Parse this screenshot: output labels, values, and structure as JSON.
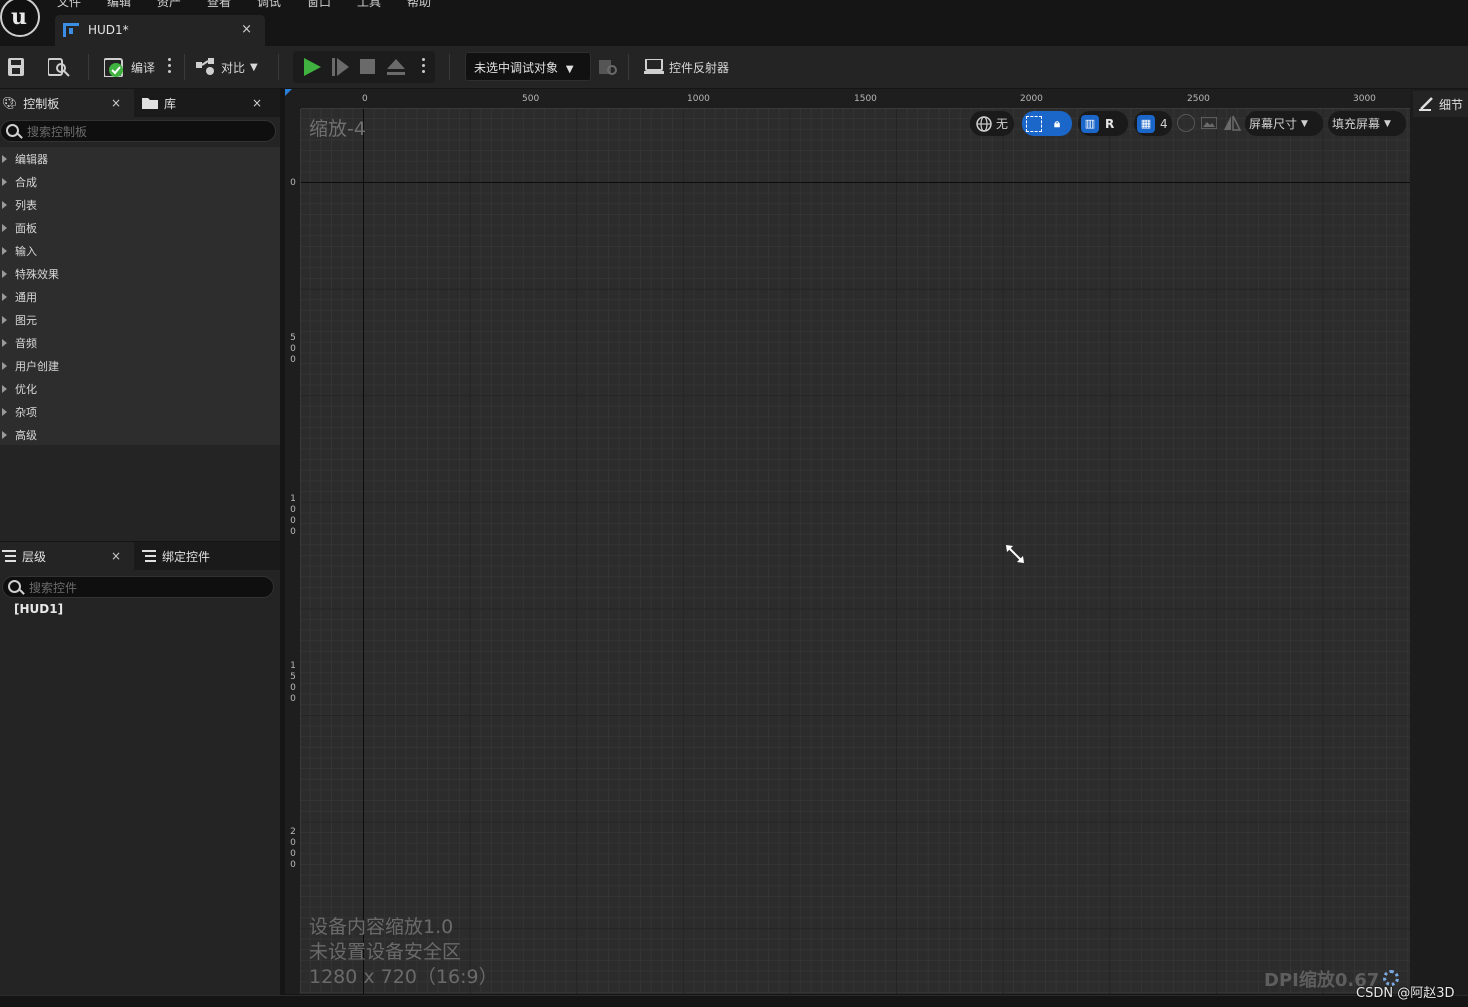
{
  "menu": {
    "items": [
      "文件",
      "编辑",
      "资产",
      "查看",
      "调试",
      "窗口",
      "工具",
      "帮助"
    ]
  },
  "document_tab": {
    "label": "HUD1*",
    "close": "×"
  },
  "toolbar": {
    "compile_label": "编译",
    "diff_label": "对比",
    "debug_object": "未选中调试对象",
    "widget_reflector_label": "控件反射器"
  },
  "palette": {
    "tab_label": "控制板",
    "library_tab_label": "库",
    "close": "×",
    "search_placeholder": "搜索控制板",
    "categories": [
      "编辑器",
      "合成",
      "列表",
      "面板",
      "输入",
      "特殊效果",
      "通用",
      "图元",
      "音频",
      "用户创建",
      "优化",
      "杂项",
      "高级"
    ]
  },
  "hierarchy": {
    "tab_label": "层级",
    "bind_tab_label": "绑定控件",
    "close": "×",
    "search_placeholder": "搜索控件",
    "root": "[HUD1]"
  },
  "canvas": {
    "zoom_label": "缩放-4",
    "ruler_top": [
      "0",
      "500",
      "1000",
      "1500",
      "2000",
      "2500",
      "3000"
    ],
    "ruler_left": [
      "0",
      "500",
      "1000",
      "1500",
      "2000"
    ],
    "info_lines": [
      "设备内容缩放1.0",
      "未设置设备安全区",
      "1280 x 720（16:9）"
    ],
    "dpi_label": "DPI缩放0.67",
    "toolbar": {
      "world_label": "无",
      "r_label": "R",
      "grid_label": "4",
      "screen_size": "屏幕尺寸",
      "fill_screen": "填充屏幕"
    }
  },
  "details": {
    "tab_label": "细节"
  },
  "watermark": "CSDN @阿赵3D",
  "colors": {
    "accent": "#1b66c9",
    "play": "#3fb23f",
    "background": "#242424",
    "grid": "#2c2c2c"
  }
}
